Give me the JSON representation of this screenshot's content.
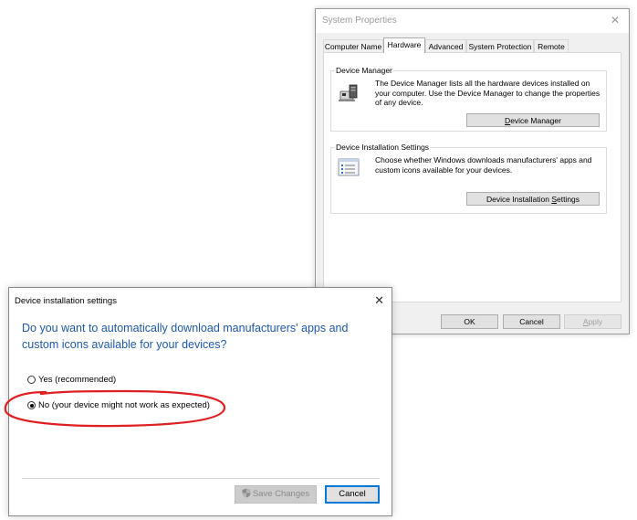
{
  "system_properties": {
    "title": "System Properties",
    "close_glyph": "✕",
    "tabs": [
      {
        "label": "Computer Name",
        "active": false
      },
      {
        "label": "Hardware",
        "active": true
      },
      {
        "label": "Advanced",
        "active": false
      },
      {
        "label": "System Protection",
        "active": false
      },
      {
        "label": "Remote",
        "active": false
      }
    ],
    "device_manager": {
      "group_label": "Device Manager",
      "description": "The Device Manager lists all the hardware devices installed on your computer. Use the Device Manager to change the properties of any device.",
      "button_label_pre": "",
      "button_label_ul": "D",
      "button_label_post": "evice Manager",
      "icon": "device-manager-icon"
    },
    "device_installation": {
      "group_label": "Device Installation Settings",
      "description": "Choose whether Windows downloads manufacturers' apps and custom icons available for your devices.",
      "button_label_pre": "Device Installation ",
      "button_label_ul": "S",
      "button_label_post": "ettings",
      "icon": "settings-list-icon"
    },
    "buttons": {
      "ok": "OK",
      "cancel": "Cancel",
      "apply_ul": "A",
      "apply_post": "pply"
    }
  },
  "device_installation_dialog": {
    "title": "Device installation settings",
    "close_glyph": "✕",
    "question": "Do you want to automatically download manufacturers' apps and custom icons available for your devices?",
    "options": [
      {
        "label": "Yes (recommended)",
        "checked": false
      },
      {
        "label": "No (your device might not work as expected)",
        "checked": true
      }
    ],
    "save_button": "Save Changes",
    "cancel_button": "Cancel"
  },
  "colors": {
    "question_text": "#1e5aa8",
    "highlight_ring": "#e02020",
    "focus_border": "#0078d7"
  }
}
